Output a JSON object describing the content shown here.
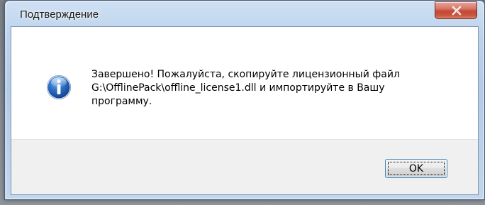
{
  "window": {
    "title": "Подтверждение",
    "close_icon": "close-x-icon"
  },
  "dialog": {
    "icon": "information-icon",
    "message_lines": [
      "Завершено! Пожалуйста, скопируйте лицензионный файл",
      "G:\\OfflinePack\\offline_license1.dll и импортируйте в Вашу",
      "программу."
    ]
  },
  "buttons": {
    "ok_label": "OK"
  },
  "colors": {
    "info_icon_blue": "#1d5fb8",
    "close_button_red": "#c9543d",
    "button_focus_border": "#3c7fb1"
  }
}
